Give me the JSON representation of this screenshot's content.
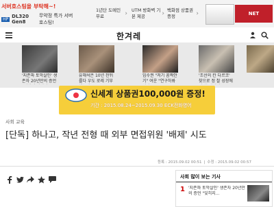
{
  "ad": {
    "hosting": {
      "title": "서버호스팅을 부탁해~!",
      "model": "DL320 Gen8",
      "tagline": "무약정 특가 서버호스팅!"
    },
    "promos": [
      "1년단 도메인 무료",
      "UTM 방화벽 기본 제공",
      "백화점 상품권 증정"
    ],
    "brand": "NET"
  },
  "header": {
    "logo": "한겨레"
  },
  "thumbnails": [
    {
      "caption": "'지존파 토막살인' 생존자 20년만의 증언 \"잊히지 않았다\""
    },
    {
      "caption": "유해석은 10년 천뒤를다 우도 로레 기부했는데"
    },
    {
      "caption": "임수권 \"저기 꼼짝안기\" 여운 \"연구하봐줬다\""
    },
    {
      "caption": "'조선의 칸 다르코' 찾으로 정 찰 성장에서 처 갈림길"
    },
    {
      "caption": ""
    }
  ],
  "banner": {
    "title": "신세계 상품권100,000원 증정!",
    "subtitle": "기간 : 2015.08.24~2015.09.30 ECK전화영어"
  },
  "article": {
    "section": "사회 교육",
    "headline": "[단독] 하나고, 작년 전형 때 외부 면접위원 '배제' 시도",
    "registered": "등록 : 2015.09.02 00:51",
    "modified": "수정 : 2015.09.02 00:57"
  },
  "share": [
    "facebook-icon",
    "twitter-icon",
    "share-icon",
    "bookmark-icon",
    "comment-icon"
  ],
  "popular": {
    "title": "사회 많이 보는 기사",
    "items": [
      {
        "rank": "1",
        "text": "'지존파 토막살인' 생존자 20년만의 증언 \"잊히지..."
      }
    ]
  }
}
